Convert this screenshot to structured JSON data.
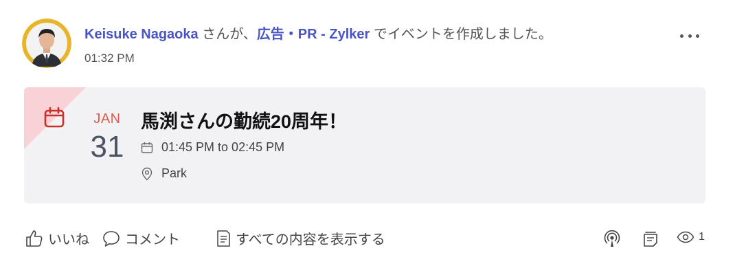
{
  "post": {
    "author": "Keisuke Nagaoka",
    "text_before_group": " さんが、",
    "group": "広告・PR - Zylker",
    "text_after_group": " でイベントを作成しました。",
    "timestamp": "01:32 PM"
  },
  "event": {
    "month": "JAN",
    "day": "31",
    "title": "馬渕さんの勤続20周年！",
    "time_range": "01:45 PM to 02:45 PM",
    "location": "Park"
  },
  "footer": {
    "like_label": "いいね",
    "comment_label": "コメント",
    "show_all_label": "すべての内容を表示する",
    "view_count": "1"
  },
  "icons": {
    "more": "more-horizontal-icon",
    "calendar": "calendar-icon",
    "location": "location-pin-icon",
    "like": "thumbs-up-icon",
    "comment": "comment-bubble-icon",
    "document": "document-icon",
    "broadcast": "broadcast-icon",
    "notes": "notes-icon",
    "views": "eye-icon"
  },
  "colors": {
    "link": "#4a55c4",
    "accent_red": "#d9534f",
    "card_bg": "#f2f2f5",
    "corner_pink": "#f8d2d7",
    "avatar_bg": "#e8b52a"
  }
}
